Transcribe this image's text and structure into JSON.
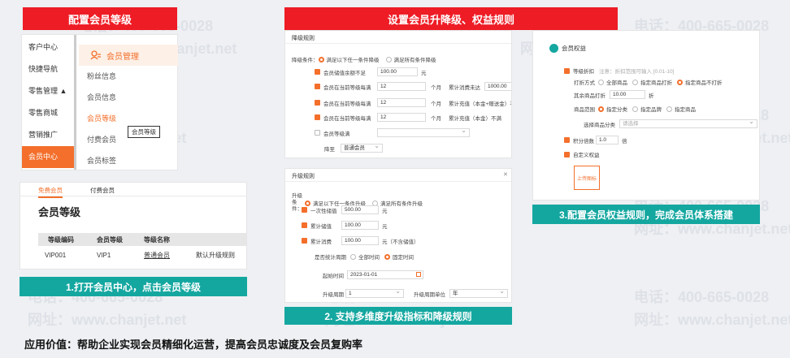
{
  "watermark": {
    "phone": "电话：400-665-0028",
    "site": "网址：www.chanjet.net"
  },
  "panel1": {
    "banner": "配置会员等级",
    "left_menu": [
      "客户中心",
      "快捷导航",
      "零售管理 ▲",
      "零售商城",
      "营销推广",
      "会员中心"
    ],
    "header": "会员管理",
    "sub_menu": [
      "粉丝信息",
      "会员信息",
      "会员等级",
      "付费会员",
      "会员标签"
    ],
    "tooltip": "会员等级"
  },
  "panel1b": {
    "tabs": [
      "免费会员",
      "付费会员"
    ],
    "title": "会员等级",
    "columns": [
      "等级编码",
      "会员等级",
      "等级名称",
      ""
    ],
    "rows": [
      [
        "VIP001",
        "VIP1",
        "普通会员",
        "默认升级规则"
      ]
    ],
    "caption": "1.打开会员中心，点击会员等级"
  },
  "panel2": {
    "banner": "设置会员升降级、权益规则",
    "down": {
      "title": "降级规则",
      "cond_label": "降级条件：",
      "opt_any": "满足以下任一条件降级",
      "opt_all": "满足所有条件降级",
      "r1_label": "会员储值余额不足",
      "r1_val": "100.00",
      "r1_unit": "元",
      "r2_label": "会员在当前等级每满",
      "r2_val": "12",
      "r2_unit": "个月",
      "r2_mid": "累计消费未达",
      "r2_val2": "1000.00",
      "r2_unit2": "元",
      "r3_label": "会员在当前等级每满",
      "r3_val": "12",
      "r3_unit": "个月",
      "r3_mid": "累计充值（本金+赠送金）不满",
      "r3_val2": "500",
      "r4_label": "会员在当前等级每满",
      "r4_val": "12",
      "r4_unit": "个月",
      "r4_mid": "累计充值（本金）不满",
      "r5_label": "会员等级满",
      "to_label": "降至",
      "to_val": "普通会员"
    },
    "up": {
      "title": "升级规则",
      "close": "✕",
      "cond_label": "升级条件：",
      "opt_any": "满足以下任一条件升级",
      "opt_all": "满足所有条件升级",
      "r1_label": "一次性储值",
      "r1_val": "500.00",
      "r1_unit": "元",
      "r2_label": "累计储值",
      "r2_val": "100.00",
      "r2_unit": "元",
      "r3_label": "累计消费",
      "r3_val": "100.00",
      "r3_unit": "元（不含储值）",
      "period_label": "是否统计周期",
      "opt_full": "全部时间",
      "opt_fixed": "固定时间",
      "start_label": "起始时间",
      "start_val": "2023-01-01",
      "cycle_label": "升级周期",
      "cycle_val": "1",
      "unit_label": "升级周期单位",
      "unit_val": "年"
    },
    "caption": "2. 支持多维度升级指标和降级规则"
  },
  "panel3": {
    "title": "会员权益",
    "r1_label": "等级折扣",
    "r1_hint": "注意：折扣范围可输入 [0.01-10]",
    "mode_label": "打折方式",
    "mode_all": "全部商品",
    "mode_some": "指定商品打折",
    "mode_none": "指定商品不打折",
    "other_label": "其余商品打折",
    "other_val": "10.00",
    "other_unit": "折",
    "range_label": "商品范围",
    "range_cat": "指定分类",
    "range_brand": "指定品牌",
    "range_goods": "指定商品",
    "cat_label": "选择商品分类",
    "cat_placeholder": "请选择",
    "r2_label": "积分倍数",
    "r2_val": "1.0",
    "r2_unit": "倍",
    "r3_label": "自定义权益",
    "upload_label": "上传图标",
    "caption": "3.配置会员权益规则，完成会员体系搭建"
  },
  "footer": "应用价值：帮助企业实现会员精细化运营，提高会员忠诚度及会员复购率",
  "colors": {
    "accent": "#f36f2b",
    "banner_red": "#ee1c25",
    "banner_teal": "#14a7a0"
  }
}
